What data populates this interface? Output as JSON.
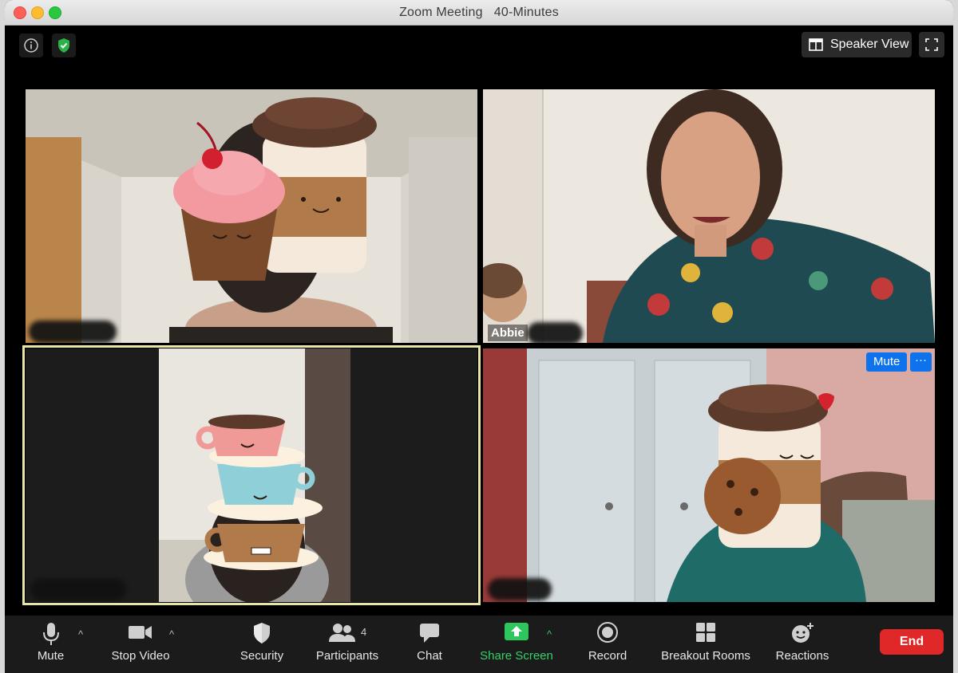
{
  "window": {
    "title": "Zoom Meeting",
    "duration": "40-Minutes"
  },
  "top_bar": {
    "speaker_view_label": "Speaker View"
  },
  "participants": [
    {
      "name": "",
      "filter": "cupcake-and-coffee-cup"
    },
    {
      "name": "Abbie",
      "filter": "none"
    },
    {
      "name": "",
      "filter": "stacked-teacups",
      "active_speaker": true
    },
    {
      "name": "",
      "filter": "coffee-cup-with-cookie",
      "mute_label": "Mute",
      "more_label": "···"
    }
  ],
  "toolbar": {
    "mute": "Mute",
    "stop_video": "Stop Video",
    "security": "Security",
    "participants": "Participants",
    "participants_count": "4",
    "chat": "Chat",
    "share_screen": "Share Screen",
    "record": "Record",
    "breakout_rooms": "Breakout Rooms",
    "reactions": "Reactions",
    "end": "End"
  },
  "colors": {
    "end_button": "#e02828",
    "mute_button": "#0e72ed",
    "share_screen": "#33d16a",
    "active_speaker_border": "#e7e6a4"
  }
}
